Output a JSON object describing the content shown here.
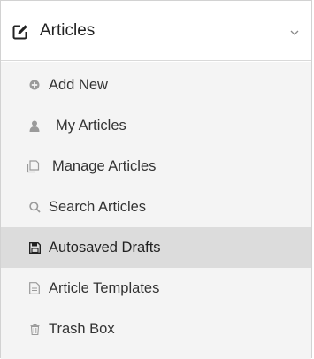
{
  "menu": {
    "title": "Articles",
    "header_icon": "edit-square-icon",
    "expand_icon": "chevron-down-icon",
    "items": [
      {
        "label": "Add New",
        "icon": "plus-circle-icon",
        "active": false
      },
      {
        "label": "My Articles",
        "icon": "user-icon",
        "active": false
      },
      {
        "label": "Manage Articles",
        "icon": "copy-documents-icon",
        "active": false
      },
      {
        "label": "Search Articles",
        "icon": "search-icon",
        "active": false
      },
      {
        "label": "Autosaved Drafts",
        "icon": "floppy-disk-icon",
        "active": true
      },
      {
        "label": "Article Templates",
        "icon": "document-template-icon",
        "active": false
      },
      {
        "label": "Trash Box",
        "icon": "trash-icon",
        "active": false
      }
    ]
  },
  "colors": {
    "active_background": "#dcdcdc",
    "list_background": "#f4f4f4",
    "icon_gray": "#9a9a9a"
  }
}
